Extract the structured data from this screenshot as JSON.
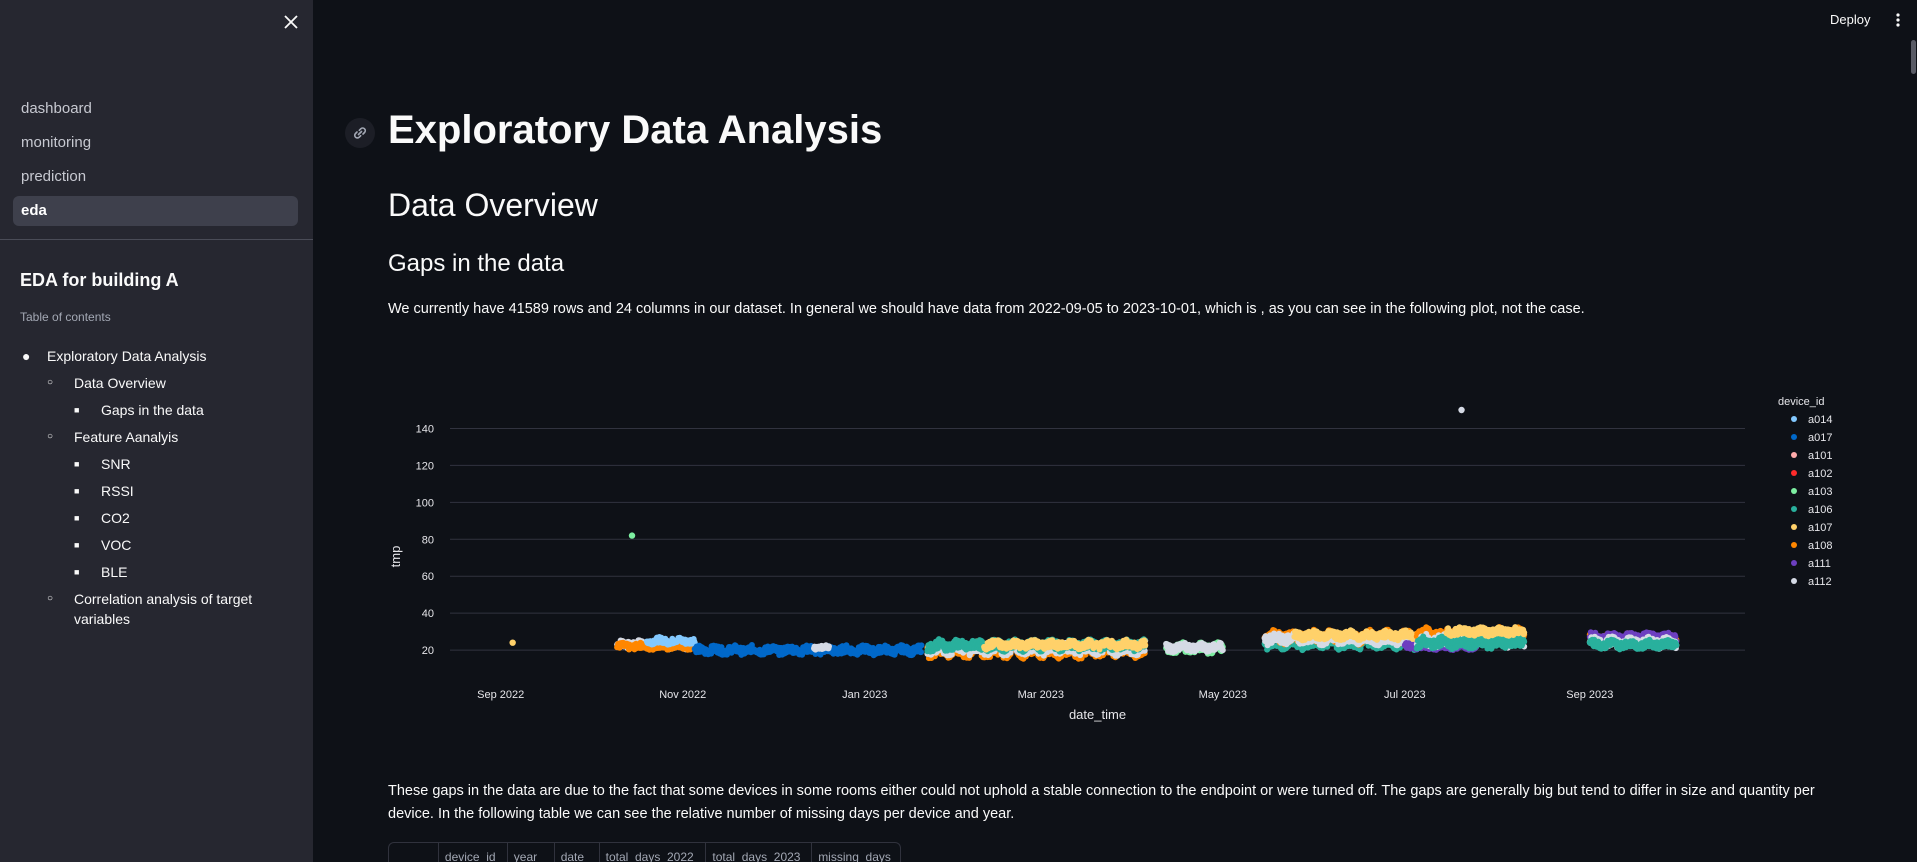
{
  "sidebar": {
    "nav": [
      {
        "label": "dashboard",
        "active": false
      },
      {
        "label": "monitoring",
        "active": false
      },
      {
        "label": "prediction",
        "active": false
      },
      {
        "label": "eda",
        "active": true
      }
    ],
    "heading": "EDA for building A",
    "caption": "Table of contents",
    "toc": [
      {
        "label": "Exploratory Data Analysis",
        "level": 1
      },
      {
        "label": "Data Overview",
        "level": 2
      },
      {
        "label": "Gaps in the data",
        "level": 3
      },
      {
        "label": "Feature Aanalyis",
        "level": 2
      },
      {
        "label": "SNR",
        "level": 3
      },
      {
        "label": "RSSI",
        "level": 3
      },
      {
        "label": "CO2",
        "level": 3
      },
      {
        "label": "VOC",
        "level": 3
      },
      {
        "label": "BLE",
        "level": 3
      },
      {
        "label": "Correlation analysis of target variables",
        "level": 2
      }
    ]
  },
  "toolbar": {
    "deploy_label": "Deploy"
  },
  "main": {
    "title": "Exploratory Data Analysis",
    "section": "Data Overview",
    "subsection": "Gaps in the data",
    "intro": "We currently have 41589 rows and 24 columns in our dataset. In general we should have data from 2022-09-05 to 2023-10-01, which is , as you can see in the following plot, not the case.",
    "gaps_text": "These gaps in the data are due to the fact that some devices in some rooms either could not uphold a stable connection to the endpoint or were turned off. The gaps are generally big but tend to differ in size and quantity per device. In the following table we can see the relative number of missing days per device and year.",
    "table_columns": [
      "",
      "device_id",
      "year",
      "date",
      "total_days_2022",
      "total_days_2023",
      "missing_days"
    ]
  },
  "chart_data": {
    "type": "scatter",
    "xlabel": "date_time",
    "ylabel": "tmp",
    "x_ticks": [
      "Sep 2022",
      "Nov 2022",
      "Jan 2023",
      "Mar 2023",
      "May 2023",
      "Jul 2023",
      "Sep 2023"
    ],
    "y_ticks": [
      20,
      40,
      60,
      80,
      100,
      120,
      140
    ],
    "ylim": [
      13,
      150
    ],
    "xlim": [
      "2022-08-15",
      "2023-10-23"
    ],
    "legend_title": "device_id",
    "legend_position": "right",
    "series": [
      {
        "name": "a014",
        "color": "#83c9ff"
      },
      {
        "name": "a017",
        "color": "#0068c9"
      },
      {
        "name": "a101",
        "color": "#ffabab"
      },
      {
        "name": "a102",
        "color": "#ff2b2b"
      },
      {
        "name": "a103",
        "color": "#7defa1"
      },
      {
        "name": "a106",
        "color": "#29b09d"
      },
      {
        "name": "a107",
        "color": "#ffd16a"
      },
      {
        "name": "a108",
        "color": "#ff8700"
      },
      {
        "name": "a111",
        "color": "#6d3fc0"
      },
      {
        "name": "a112",
        "color": "#d5dae5"
      }
    ],
    "outliers": [
      {
        "device": "a107",
        "date": "2022-09-05",
        "value": 24
      },
      {
        "device": "a103",
        "date": "2022-10-15",
        "value": 82
      },
      {
        "device": "a112",
        "date": "2023-07-20",
        "value": 150
      }
    ],
    "segments": [
      {
        "device": "a112",
        "start": "2022-10-10",
        "end": "2022-11-05",
        "base": 23,
        "spread": 2
      },
      {
        "device": "a108",
        "start": "2022-10-10",
        "end": "2022-11-05",
        "base": 22,
        "spread": 1.5
      },
      {
        "device": "a014",
        "start": "2022-10-20",
        "end": "2022-11-05",
        "base": 25,
        "spread": 1.5
      },
      {
        "device": "a017",
        "start": "2022-11-05",
        "end": "2023-01-20",
        "base": 20,
        "spread": 2
      },
      {
        "device": "a112",
        "start": "2022-12-15",
        "end": "2022-12-20",
        "base": 21.5,
        "spread": 1
      },
      {
        "device": "a108",
        "start": "2023-01-22",
        "end": "2023-04-05",
        "base": 20,
        "spread": 3.5
      },
      {
        "device": "a112",
        "start": "2023-01-22",
        "end": "2023-04-05",
        "base": 21,
        "spread": 3
      },
      {
        "device": "a106",
        "start": "2023-01-22",
        "end": "2023-04-05",
        "base": 22.5,
        "spread": 2.5
      },
      {
        "device": "a107",
        "start": "2023-02-10",
        "end": "2023-04-05",
        "base": 23,
        "spread": 2
      },
      {
        "device": "a103",
        "start": "2023-04-12",
        "end": "2023-05-01",
        "base": 21,
        "spread": 2.5
      },
      {
        "device": "a112",
        "start": "2023-04-12",
        "end": "2023-05-01",
        "base": 21.5,
        "spread": 2
      },
      {
        "device": "a106",
        "start": "2023-05-15",
        "end": "2023-07-10",
        "base": 24,
        "spread": 3
      },
      {
        "device": "a108",
        "start": "2023-05-15",
        "end": "2023-07-10",
        "base": 27,
        "spread": 3
      },
      {
        "device": "a112",
        "start": "2023-05-15",
        "end": "2023-07-10",
        "base": 26,
        "spread": 2.5
      },
      {
        "device": "a107",
        "start": "2023-05-25",
        "end": "2023-07-10",
        "base": 28,
        "spread": 2
      },
      {
        "device": "a111",
        "start": "2023-07-01",
        "end": "2023-07-25",
        "base": 22,
        "spread": 1.5
      },
      {
        "device": "a108",
        "start": "2023-07-05",
        "end": "2023-08-10",
        "base": 29,
        "spread": 2.5
      },
      {
        "device": "a112",
        "start": "2023-07-05",
        "end": "2023-08-10",
        "base": 25,
        "spread": 3
      },
      {
        "device": "a106",
        "start": "2023-07-05",
        "end": "2023-08-10",
        "base": 24,
        "spread": 2.5
      },
      {
        "device": "a107",
        "start": "2023-07-15",
        "end": "2023-08-10",
        "base": 30,
        "spread": 2
      },
      {
        "device": "a108",
        "start": "2023-09-01",
        "end": "2023-09-30",
        "base": 26,
        "spread": 2.5
      },
      {
        "device": "a111",
        "start": "2023-09-01",
        "end": "2023-09-30",
        "base": 27,
        "spread": 2
      },
      {
        "device": "a112",
        "start": "2023-09-01",
        "end": "2023-09-30",
        "base": 24,
        "spread": 2.5
      },
      {
        "device": "a106",
        "start": "2023-09-01",
        "end": "2023-09-30",
        "base": 23,
        "spread": 2
      }
    ]
  }
}
